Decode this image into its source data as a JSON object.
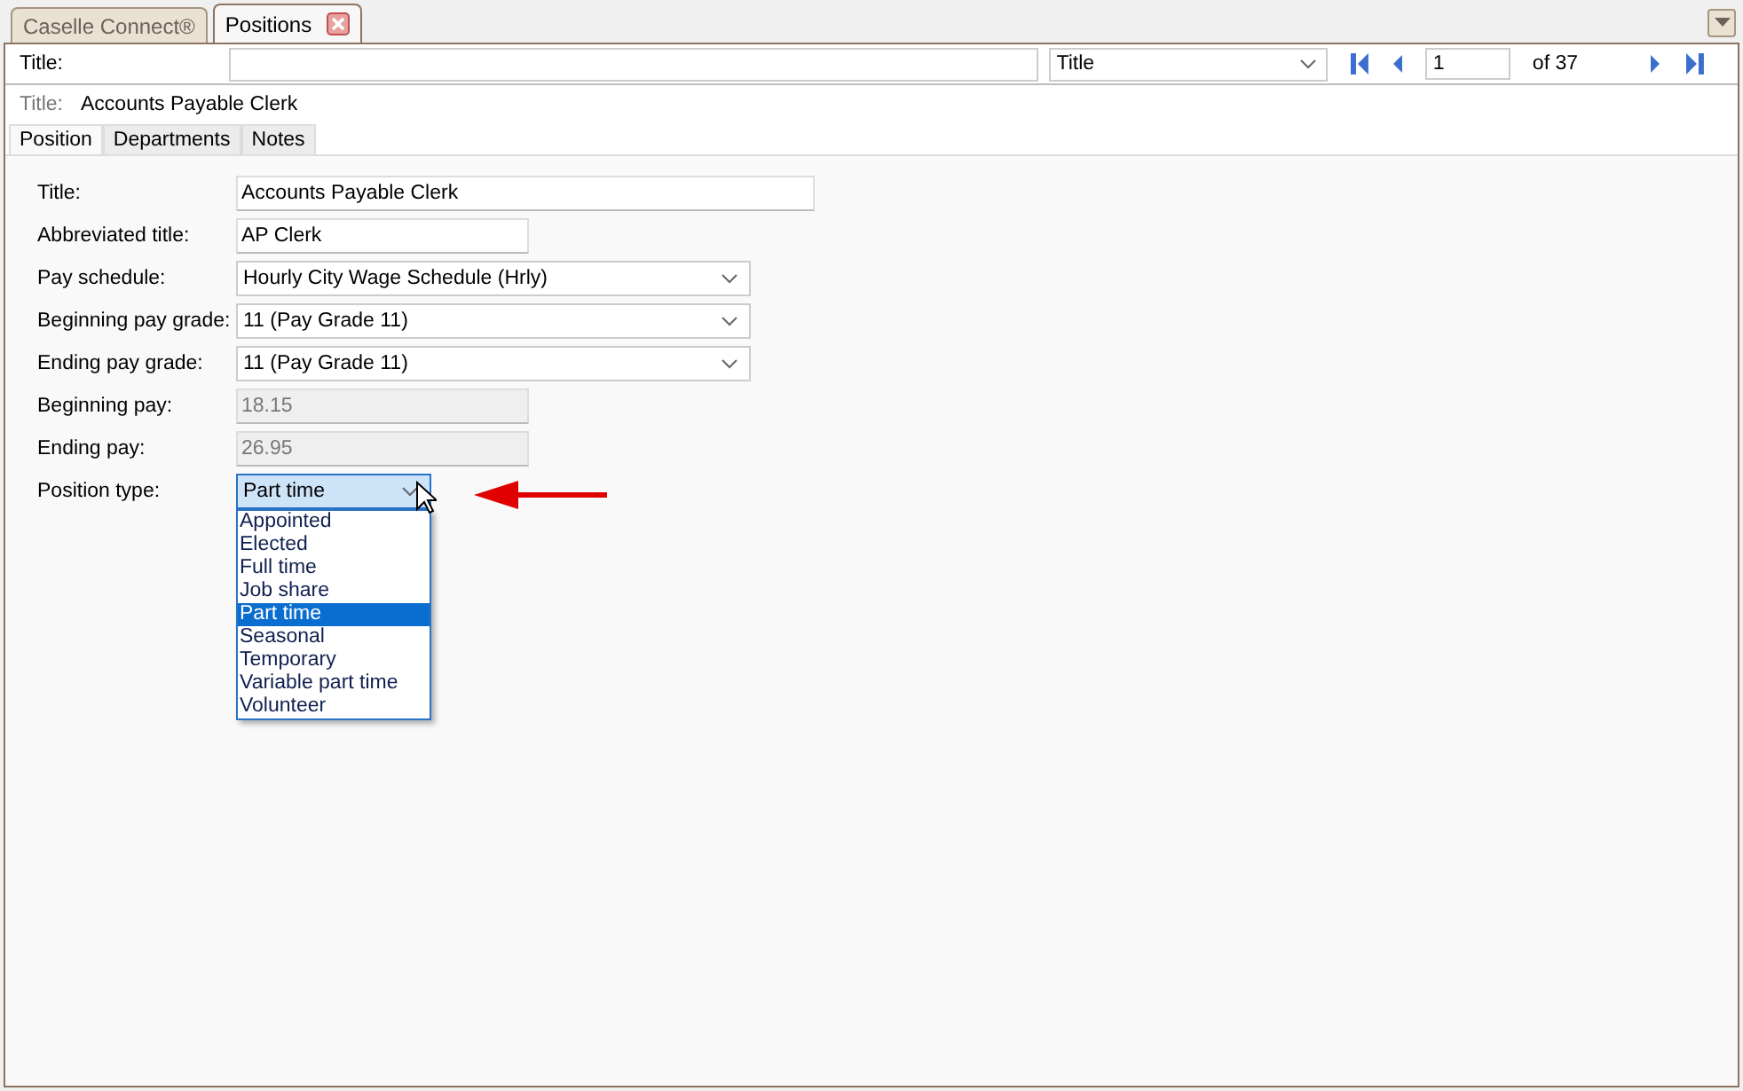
{
  "doc_tabs": [
    {
      "label": "Caselle Connect®",
      "selected": false,
      "closable": false
    },
    {
      "label": "Positions",
      "selected": true,
      "closable": true
    }
  ],
  "toolbar": {
    "title_label": "Title:",
    "sort_field": "Title",
    "page": "1",
    "page_total": "of 37"
  },
  "record_header": {
    "label": "Title:",
    "value": "Accounts Payable Clerk"
  },
  "tabs": [
    {
      "label": "Position",
      "selected": true
    },
    {
      "label": "Departments",
      "selected": false
    },
    {
      "label": "Notes",
      "selected": false
    }
  ],
  "fields": [
    {
      "label": "Title:",
      "kind": "text",
      "value": "Accounts Payable Clerk"
    },
    {
      "label": "Abbreviated title:",
      "kind": "short_text",
      "value": "AP Clerk"
    },
    {
      "label": "Pay schedule:",
      "kind": "select",
      "value": "Hourly City Wage Schedule (Hrly)"
    },
    {
      "label": "Beginning pay grade:",
      "kind": "select",
      "value": "11 (Pay Grade 11)"
    },
    {
      "label": "Ending pay grade:",
      "kind": "select",
      "value": "11 (Pay Grade 11)"
    },
    {
      "label": "Beginning pay:",
      "kind": "readonly",
      "value": "18.15"
    },
    {
      "label": "Ending pay:",
      "kind": "readonly",
      "value": "26.95"
    },
    {
      "label": "Position type:",
      "kind": "dropdown",
      "value": "Part time",
      "expanded": true,
      "options": [
        {
          "label": "Appointed",
          "selected": false
        },
        {
          "label": "Elected",
          "selected": false
        },
        {
          "label": "Full time",
          "selected": false
        },
        {
          "label": "Job share",
          "selected": false
        },
        {
          "label": "Part time",
          "selected": true
        },
        {
          "label": "Seasonal",
          "selected": false
        },
        {
          "label": "Temporary",
          "selected": false
        },
        {
          "label": "Variable part time",
          "selected": false
        },
        {
          "label": "Volunteer",
          "selected": false
        }
      ]
    }
  ]
}
